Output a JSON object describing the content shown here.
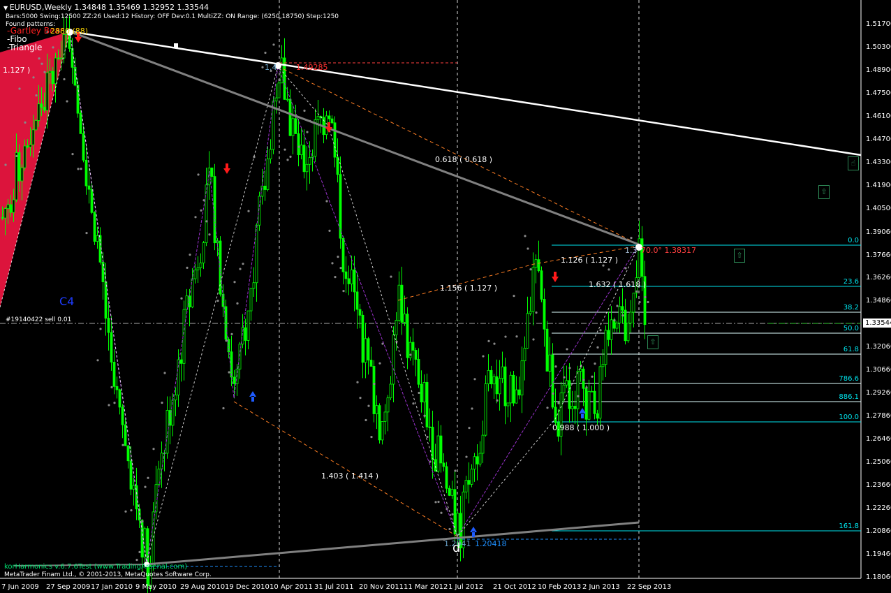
{
  "header": {
    "symbol_line": "EURUSD,Weekly  1.34848 1.35469 1.32952 1.33544",
    "settings_line": "Bars:5000  Swing:12500  ZZ:26  Used:12  History: OFF Dev:0.1  MultiZZ: ON  Range: (6250,18750)  Step:1250",
    "found_label": "Found patterns:",
    "patterns": [
      "-Gartley Bear",
      "-Fibo",
      "-Triangle"
    ],
    "gartley_overlay": "2880 (88)"
  },
  "price_axis": [
    "1.51700",
    "1.50300",
    "1.48900",
    "1.47500",
    "1.46100",
    "1.44700",
    "1.43300",
    "1.41900",
    "1.40500",
    "1.39060",
    "1.37660",
    "1.36260",
    "1.34860",
    "1.32060",
    "1.30660",
    "1.29260",
    "1.27860",
    "1.26460",
    "1.25060",
    "1.23660",
    "1.22260",
    "1.20860",
    "1.19460",
    "1.18060"
  ],
  "current_price": "1.33544",
  "date_axis": [
    "7 Jun 2009",
    "27 Sep 2009",
    "17 Jan 2010",
    "9 May 2010",
    "29 Aug 2010",
    "19 Dec 2010",
    "10 Apr 2011",
    "31 Jul 2011",
    "20 Nov 2011",
    "11 Mar 2012",
    "1 Jul 2012",
    "21 Oct 2012",
    "10 Feb 2013",
    "2 Jun 2013",
    "22 Sep 2013"
  ],
  "fib_levels": [
    "0.0",
    "23.6",
    "38.2",
    "50.0",
    "61.8",
    "786.6",
    "886.1",
    "100.0",
    "161.8"
  ],
  "labels": {
    "left_ratio": "1.127 )",
    "c4": "C4",
    "order": "#19140422 sell 0.01",
    "r1": "0.618 ( 0.618 )",
    "r2": "1.156 ( 1.127 )",
    "r3": "1.126 ( 1.127 )",
    "r4": "1.632 ( 1.618 )",
    "r5": "0.988 ( 1.000 )",
    "r6": "1.403 ( 1.414 )",
    "top_a": "1.4",
    "top_b": "1.49285",
    "right_a": "1.3",
    "right_b": "70.0° 1.38317",
    "bottom_a": "1.2041",
    "bottom_b": "1.20418",
    "point_d": "d"
  },
  "footer": {
    "indicator": "korHarmonics v.6.7.6Test (www.TradingArsenal.com)",
    "copyright": "MetaTrader Finam Ltd., © 2001-2013, MetaQuotes Software Corp."
  },
  "colors": {
    "candle": "#00ff00",
    "fib": "#00e5ee",
    "bear_zone": "#dc143c",
    "trend": "#ffffff",
    "channel": "#808080"
  }
}
